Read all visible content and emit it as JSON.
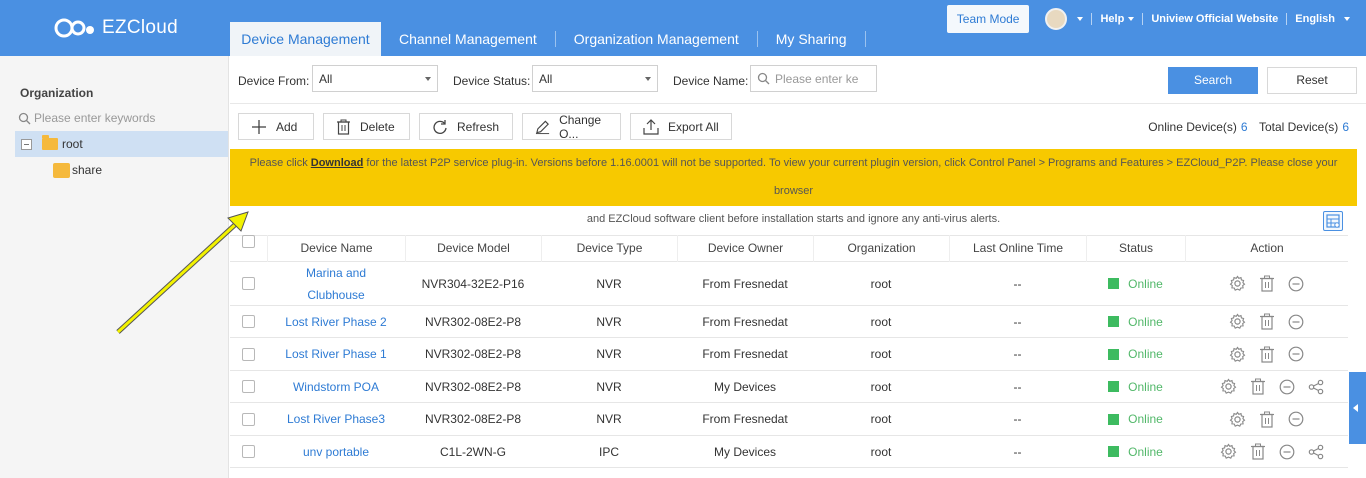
{
  "header": {
    "app_name": "EZCloud",
    "tabs": [
      {
        "label": "Device Management",
        "active": true
      },
      {
        "label": "Channel Management",
        "active": false
      },
      {
        "label": "Organization Management",
        "active": false
      },
      {
        "label": "My Sharing",
        "active": false
      }
    ],
    "team_mode": "Team Mode",
    "help": "Help",
    "website": "Uniview Official Website",
    "language": "English",
    "brand_color": "#4a90e2"
  },
  "sidebar": {
    "title": "Organization",
    "search_placeholder": "Please enter keywords",
    "tree": [
      {
        "label": "root",
        "selected": true
      },
      {
        "label": "share",
        "selected": false
      }
    ]
  },
  "filter": {
    "device_from_label": "Device From:",
    "device_from_value": "All",
    "device_status_label": "Device Status:",
    "device_status_value": "All",
    "device_name_label": "Device Name:",
    "device_name_placeholder": "Please enter ke",
    "search_button": "Search",
    "reset_button": "Reset"
  },
  "toolbar": {
    "add": "Add",
    "delete": "Delete",
    "refresh": "Refresh",
    "change": "Change O...",
    "export": "Export All",
    "online_label": "Online Device(s)",
    "online_count": "6",
    "total_label": "Total Device(s)",
    "total_count": "6"
  },
  "notice": {
    "prefix": "Please click ",
    "link": "Download",
    "line1_rest": " for the latest P2P service plug-in. Versions before 1.16.0001 will not be supported. To view your current plugin version, click Control Panel > Programs and Features > EZCloud_P2P. Please close your browser",
    "line2": "and EZCloud software client before installation starts and ignore any anti-virus alerts.",
    "bg_color": "#f7c900"
  },
  "table": {
    "headers": [
      "Device Name",
      "Device Model",
      "Device Type",
      "Device Owner",
      "Organization",
      "Last Online Time",
      "Status",
      "Action"
    ],
    "rows": [
      {
        "name": "Marina and Clubhouse",
        "model": "NVR304-32E2-P16",
        "type": "NVR",
        "owner": "From Fresnedat",
        "org": "root",
        "last_online": "--",
        "status": "Online",
        "shared": false
      },
      {
        "name": "Lost River Phase 2",
        "model": "NVR302-08E2-P8",
        "type": "NVR",
        "owner": "From Fresnedat",
        "org": "root",
        "last_online": "--",
        "status": "Online",
        "shared": false
      },
      {
        "name": "Lost River Phase 1",
        "model": "NVR302-08E2-P8",
        "type": "NVR",
        "owner": "From Fresnedat",
        "org": "root",
        "last_online": "--",
        "status": "Online",
        "shared": false
      },
      {
        "name": "Windstorm POA",
        "model": "NVR302-08E2-P8",
        "type": "NVR",
        "owner": "My Devices",
        "org": "root",
        "last_online": "--",
        "status": "Online",
        "shared": true
      },
      {
        "name": "Lost River Phase3",
        "model": "NVR302-08E2-P8",
        "type": "NVR",
        "owner": "From Fresnedat",
        "org": "root",
        "last_online": "--",
        "status": "Online",
        "shared": false
      },
      {
        "name": "unv portable",
        "model": "C1L-2WN-G",
        "type": "IPC",
        "owner": "My Devices",
        "org": "root",
        "last_online": "--",
        "status": "Online",
        "shared": true
      }
    ],
    "status_color": "#3dbb60"
  },
  "annotation": {
    "arrow_color": "#f2f200"
  }
}
